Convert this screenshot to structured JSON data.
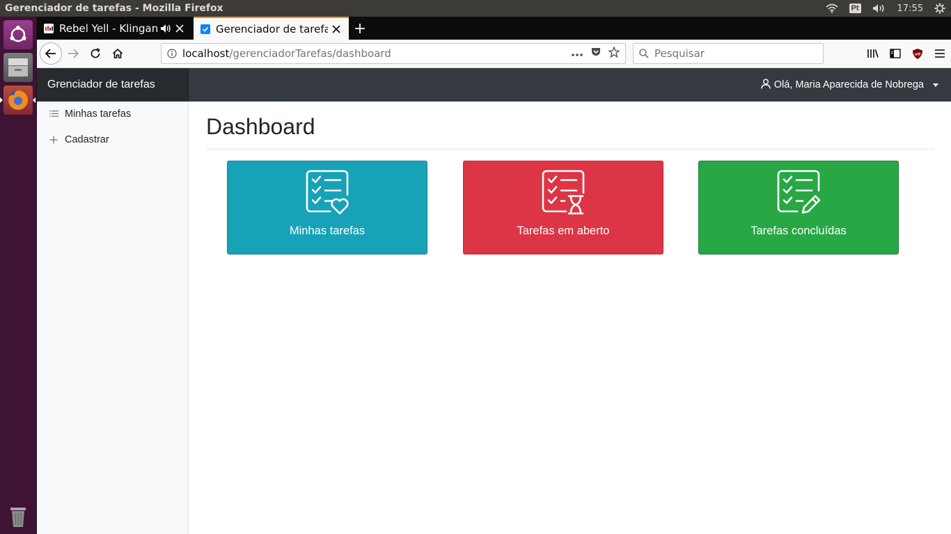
{
  "os": {
    "window_title": "Gerenciador de tarefas - Mozilla Firefox",
    "lang_indicator": "Pt",
    "clock": "17:55"
  },
  "browser": {
    "tabs": [
      {
        "label": "Rebel Yell - Klingande",
        "active": false
      },
      {
        "label": "Gerenciador de tarefas",
        "active": true
      }
    ],
    "url_host": "localhost",
    "url_path": "/gerenciadorTarefas/dashboard",
    "search_placeholder": "Pesquisar"
  },
  "app": {
    "brand": "Grenciador de tarefas",
    "user_greeting": "Olá, Maria Aparecida de Nobrega",
    "sidebar": [
      {
        "label": "Minhas tarefas",
        "icon": "list-icon"
      },
      {
        "label": "Cadastrar",
        "icon": "plus-icon"
      }
    ],
    "page_title": "Dashboard",
    "cards": [
      {
        "label": "Minhas tarefas",
        "icon": "checklist-heart-icon",
        "color": "#17a2b8"
      },
      {
        "label": "Tarefas em aberto",
        "icon": "checklist-hourglass-icon",
        "color": "#dc3545"
      },
      {
        "label": "Tarefas concluídas",
        "icon": "checklist-pencil-icon",
        "color": "#28a745"
      }
    ]
  },
  "colors": {
    "header_bg": "#343a40",
    "brand_bg": "#272b30",
    "sidebar_bg": "#f8f9fa",
    "launcher_bg": "#3e1333",
    "active_tab_accent": "#ff9400"
  }
}
